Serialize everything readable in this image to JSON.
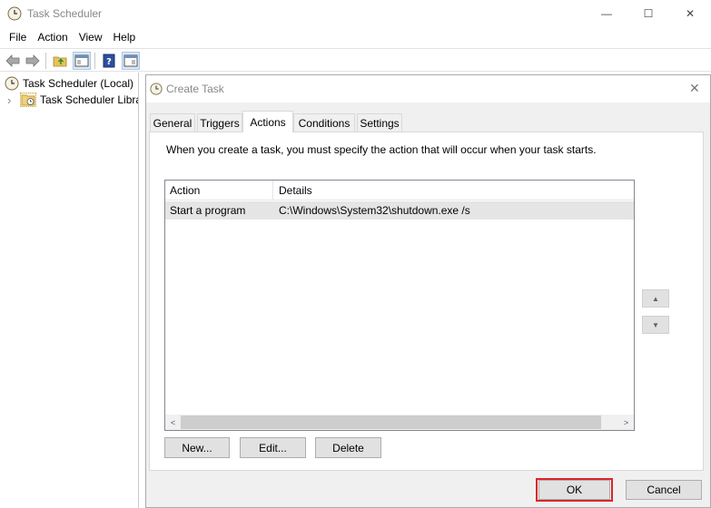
{
  "window": {
    "title": "Task Scheduler",
    "icon": "clock-icon",
    "controls": {
      "minimize": "—",
      "maximize": "☐",
      "close": "✕"
    }
  },
  "menu": [
    "File",
    "Action",
    "View",
    "Help"
  ],
  "toolbar": {
    "icons": [
      "back-arrow-icon",
      "forward-arrow-icon",
      "folder-up-icon",
      "show-hide-console-tree-icon",
      "help-icon",
      "show-action-pane-icon"
    ]
  },
  "tree": {
    "items": [
      {
        "label": "Task Scheduler (Local)",
        "icon": "clock-icon"
      },
      {
        "label": "Task Scheduler Library",
        "icon": "folder-clock-icon",
        "expander": "›"
      }
    ]
  },
  "dialog": {
    "title": "Create Task",
    "close": "✕",
    "tabs": [
      "General",
      "Triggers",
      "Actions",
      "Conditions",
      "Settings"
    ],
    "active_tab": "Actions",
    "description": "When you create a task, you must specify the action that will occur when your task starts.",
    "table": {
      "columns": [
        "Action",
        "Details"
      ],
      "rows": [
        {
          "action": "Start a program",
          "details": "C:\\Windows\\System32\\shutdown.exe /s"
        }
      ]
    },
    "scroll": {
      "left": "<",
      "right": ">"
    },
    "move_up": "▲",
    "move_down": "▼",
    "buttons": {
      "new": "New...",
      "edit": "Edit...",
      "delete": "Delete",
      "ok": "OK",
      "cancel": "Cancel"
    },
    "highlight_color": "#d9262b"
  }
}
